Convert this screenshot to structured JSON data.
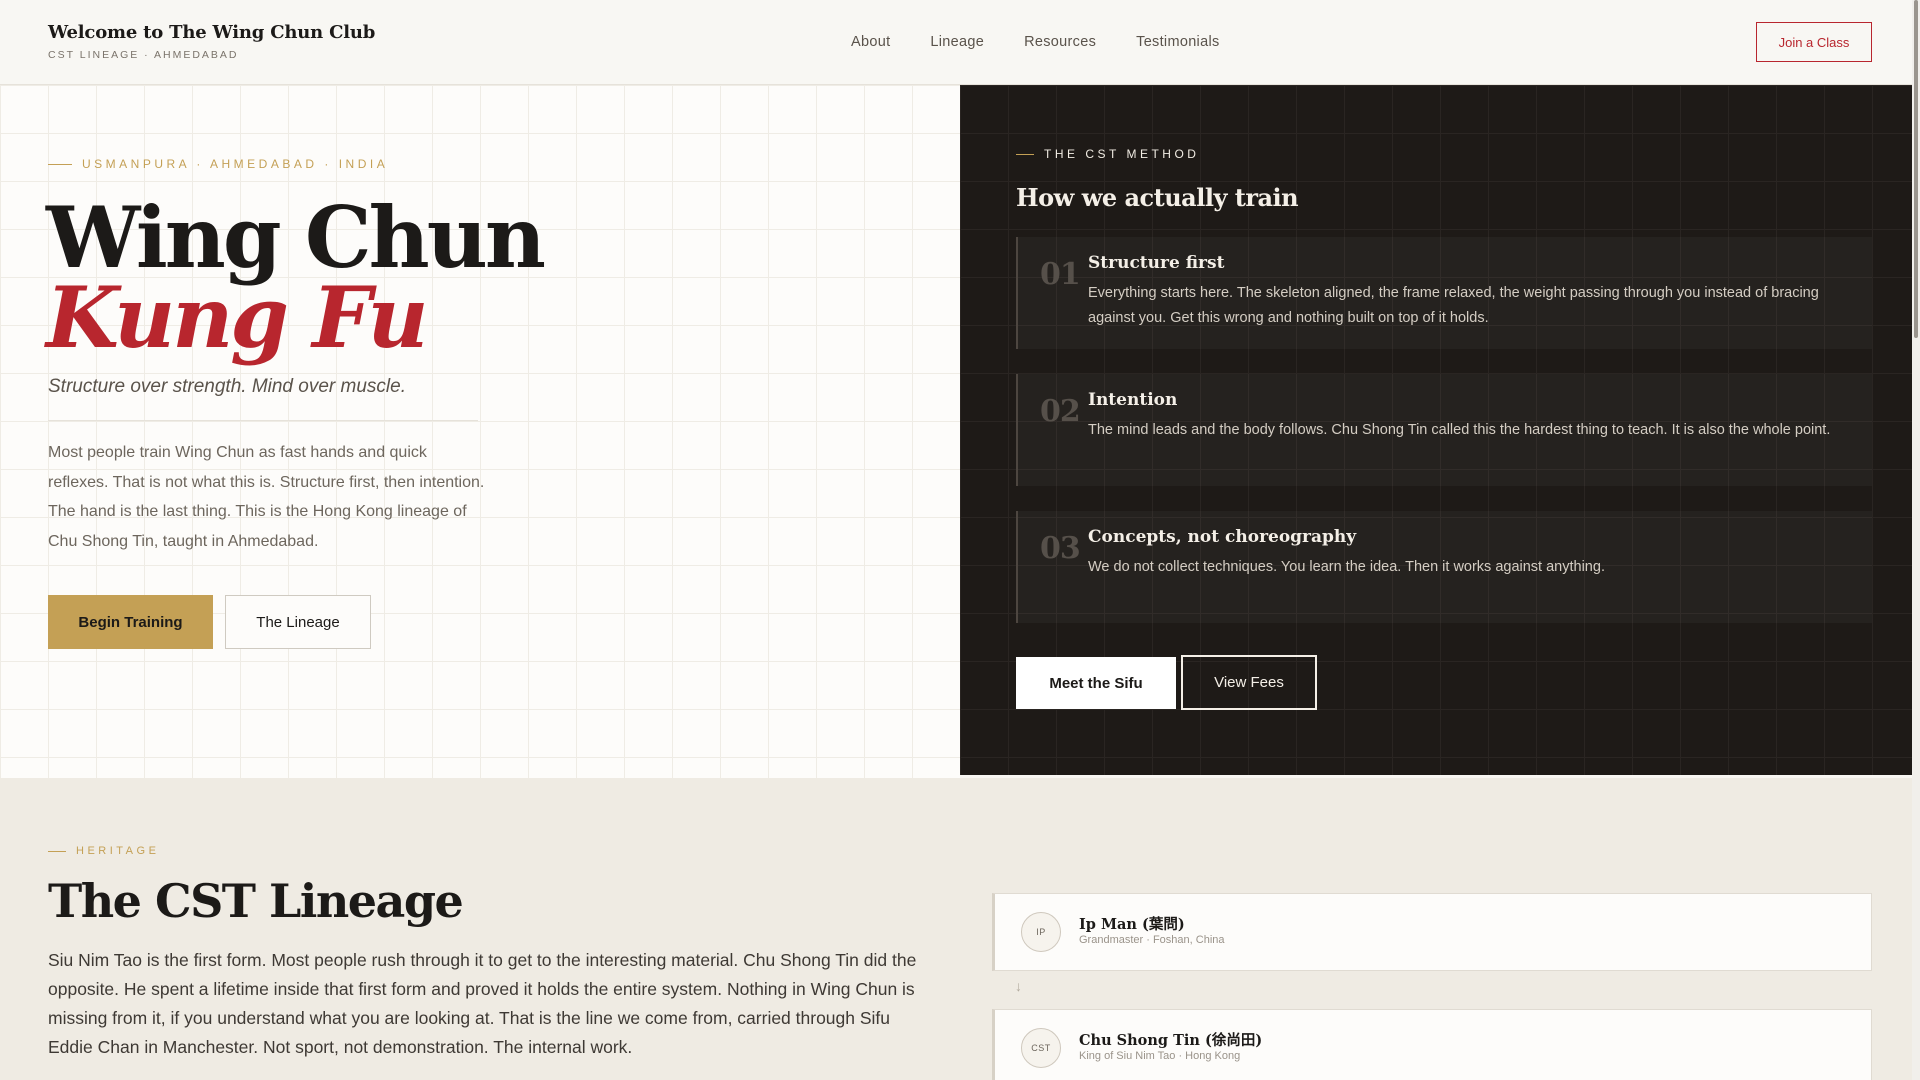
{
  "header": {
    "brand_title": "Welcome to The Wing Chun Club",
    "brand_subtitle": "CST LINEAGE · AHMEDABAD",
    "nav": [
      "About",
      "Lineage",
      "Resources",
      "Testimonials"
    ],
    "cta_label": "Join a Class"
  },
  "hero": {
    "eyebrow": "USMANPURA · AHMEDABAD · INDIA",
    "title": "Wing Chun",
    "title_accent": "Kung Fu",
    "tagline": "Structure over strength. Mind over muscle.",
    "body": "Most people train Wing Chun as fast hands and quick reflexes. That is not what this is. Structure first, then intention. The hand is the last thing. This is the Hong Kong lineage of Chu Shong Tin, taught in Ahmedabad.",
    "primary_button": "Begin Training",
    "secondary_button": "The Lineage"
  },
  "method": {
    "eyebrow": "THE CST METHOD",
    "title": "How we actually train",
    "steps": [
      {
        "num": "01",
        "title": "Structure first",
        "body": "Everything starts here. The skeleton aligned, the frame relaxed, the weight passing through you instead of bracing against you. Get this wrong and nothing built on top of it holds."
      },
      {
        "num": "02",
        "title": "Intention",
        "body": "The mind leads and the body follows. Chu Shong Tin called this the hardest thing to teach. It is also the whole point."
      },
      {
        "num": "03",
        "title": "Concepts, not choreography",
        "body": "We do not collect techniques. You learn the idea. Then it works against anything."
      }
    ],
    "primary_button": "Meet the Sifu",
    "secondary_button": "View Fees"
  },
  "heritage": {
    "eyebrow": "HERITAGE",
    "title": "The CST Lineage",
    "body": "Siu Nim Tao is the first form. Most people rush through it to get to the interesting material. Chu Shong Tin did the opposite. He spent a lifetime inside that first form and proved it holds the entire system. Nothing in Wing Chun is missing from it, if you understand what you are looking at. That is the line we come from, carried through Sifu Eddie Chan in Manchester. Not sport, not demonstration. The internal work.",
    "lineage": [
      {
        "initials": "IP",
        "name": "Ip Man (葉問)",
        "role": "Grandmaster · Foshan, China"
      },
      {
        "initials": "CST",
        "name": "Chu Shong Tin (徐尚田)",
        "role": "King of Siu Nim Tao · Hong Kong"
      }
    ],
    "arrow": "↓"
  },
  "colors": {
    "accent_red": "#b8262e",
    "accent_gold": "#c4a055",
    "dark_bg": "#1e1a17",
    "light_bg": "#fdfcfa"
  }
}
